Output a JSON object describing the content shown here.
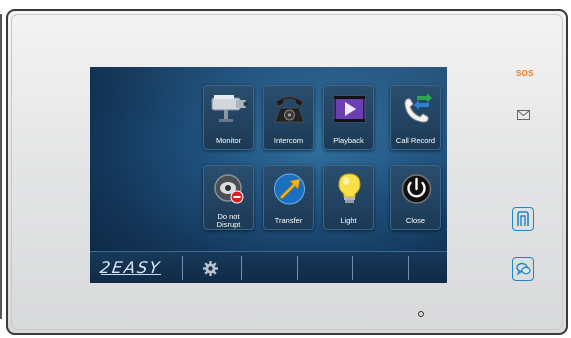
{
  "device": {
    "sos_label": "SOS",
    "message_icon": "envelope-icon",
    "unlock_icon": "door-unlock-icon",
    "talk_icon": "talk-icon"
  },
  "screen": {
    "tiles": [
      {
        "label": "Monitor",
        "icon": "camera-icon"
      },
      {
        "label": "Intercom",
        "icon": "telephone-icon"
      },
      {
        "label": "Playback",
        "icon": "video-play-icon"
      },
      {
        "label": "Call Record",
        "icon": "call-record-icon"
      },
      {
        "label_line1": "Do not",
        "label_line2": "Disrupt",
        "icon": "do-not-disturb-icon"
      },
      {
        "label": "Transfer",
        "icon": "transfer-arrow-icon"
      },
      {
        "label": "Light",
        "icon": "light-bulb-icon"
      },
      {
        "label": "Close",
        "icon": "power-icon"
      }
    ],
    "taskbar": {
      "logo_text": "2EASY",
      "settings_icon": "gear-icon"
    }
  },
  "colors": {
    "accent_blue": "#1f87c8",
    "sos_orange": "#ee7a1e",
    "screen_bg": "#1d4e7a"
  }
}
